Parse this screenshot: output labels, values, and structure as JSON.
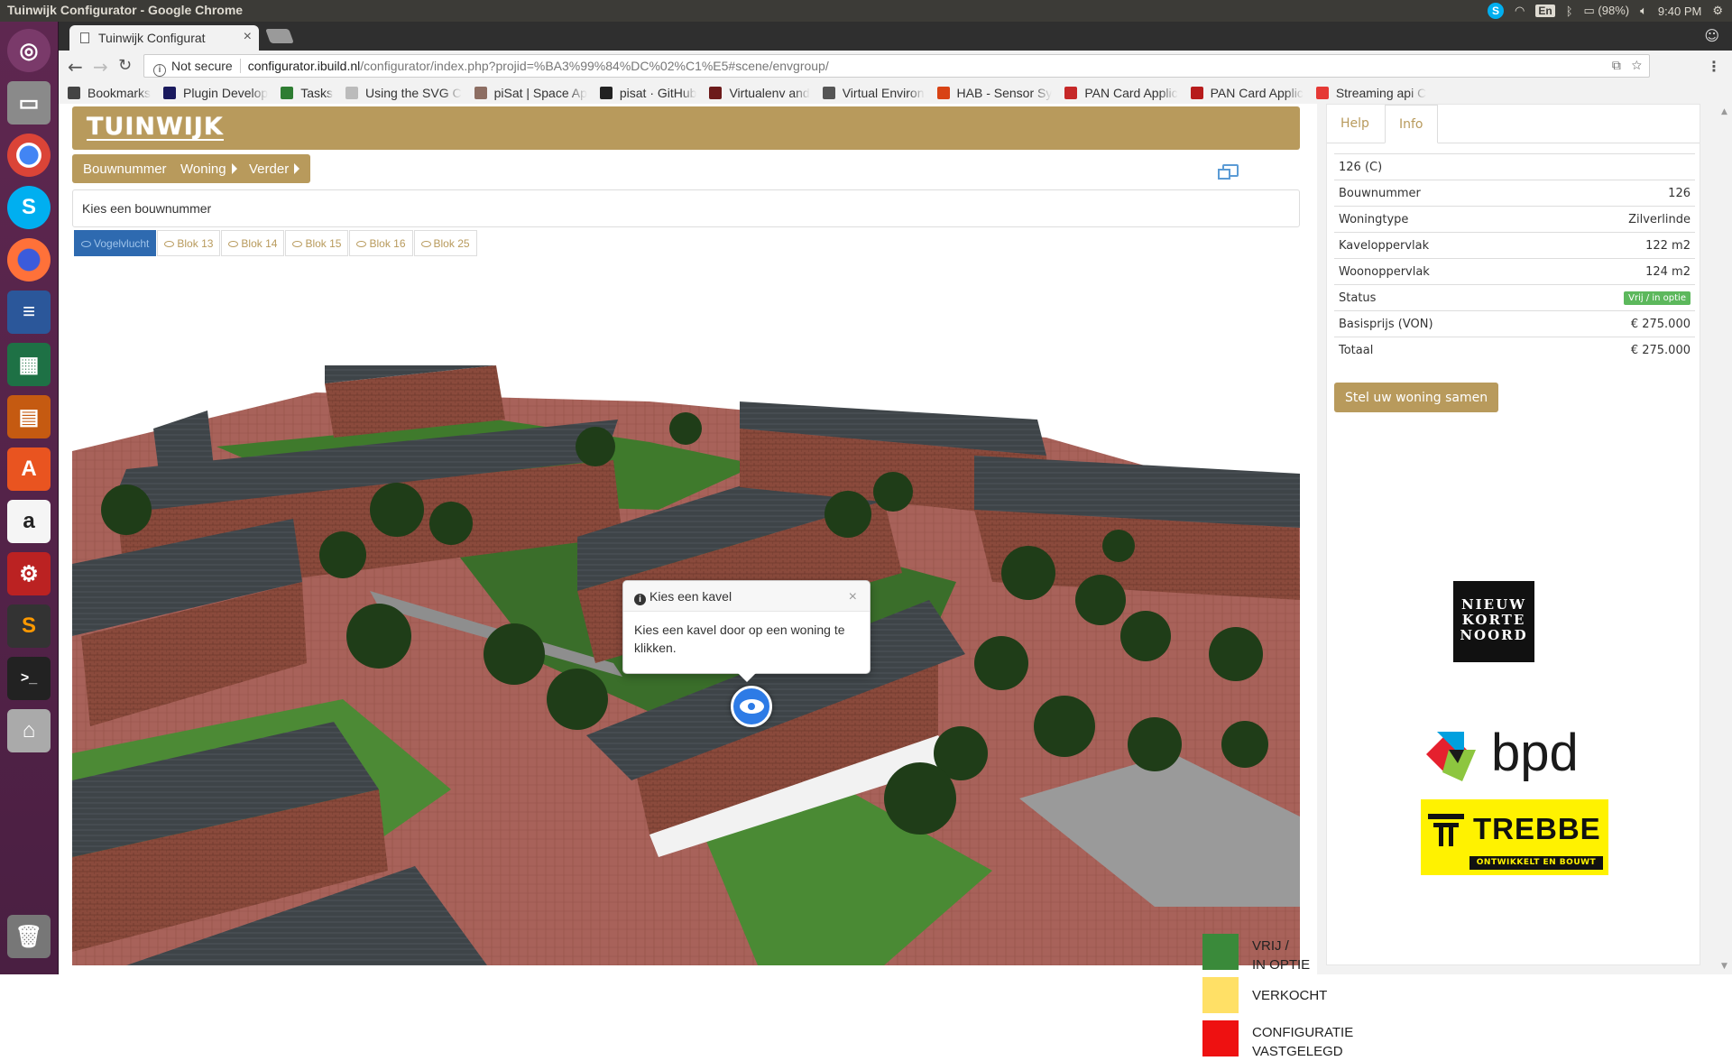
{
  "os": {
    "window_title": "Tuinwijk Configurator - Google Chrome",
    "language": "En",
    "battery": "(98%)",
    "clock": "9:40 PM"
  },
  "browser": {
    "tab_title": "Tuinwijk Configurat",
    "security": "Not secure",
    "url_host": "configurator.ibuild.nl",
    "url_path": "/configurator/index.php?projid=%BA3%99%84%DC%02%C1%E5#scene/envgroup/",
    "bookmarks": [
      {
        "label": "Bookmarks",
        "icon": "star-icon",
        "color": "#444444"
      },
      {
        "label": "Plugin Develop",
        "icon": "plugin-icon",
        "color": "#1a1a5e"
      },
      {
        "label": "Tasks",
        "icon": "tasks-icon",
        "color": "#2e7d32"
      },
      {
        "label": "Using the SVG C",
        "icon": "page-icon",
        "color": "#bbbbbb"
      },
      {
        "label": "piSat | Space Ap",
        "icon": "rocket-icon",
        "color": "#8d6e63"
      },
      {
        "label": "pisat · GitHub",
        "icon": "github-icon",
        "color": "#222222"
      },
      {
        "label": "Virtualenv and",
        "icon": "python-icon",
        "color": "#6d1b1b"
      },
      {
        "label": "Virtual Environ",
        "icon": "doc-icon",
        "color": "#555555"
      },
      {
        "label": "HAB - Sensor Sy",
        "icon": "hab-icon",
        "color": "#d84315"
      },
      {
        "label": "PAN Card Applic",
        "icon": "ca-icon",
        "color": "#c62828"
      },
      {
        "label": "PAN Card Applic",
        "icon": "nsdl-icon",
        "color": "#b71c1c"
      },
      {
        "label": "Streaming api C",
        "icon": "youtube-icon",
        "color": "#e53935"
      }
    ]
  },
  "app": {
    "logo_text": "TUINWIJK",
    "nav": [
      {
        "label": "Bouwnummer"
      },
      {
        "label": "Woning"
      },
      {
        "label": "Verder"
      }
    ],
    "prompt": "Kies een bouwnummer",
    "view_tabs": [
      {
        "label": "Vogelvlucht",
        "active": true
      },
      {
        "label": "Blok 13",
        "active": false
      },
      {
        "label": "Blok 14",
        "active": false
      },
      {
        "label": "Blok 15",
        "active": false
      },
      {
        "label": "Blok 16",
        "active": false
      },
      {
        "label": "Blok 25",
        "active": false
      }
    ],
    "popover": {
      "title": "Kies een kavel",
      "close": "×",
      "body": "Kies een kavel door op een woning te klikken."
    },
    "legend": [
      {
        "line1": "VRIJ /",
        "line2": "IN OPTIE",
        "color": "#3a8a3a"
      },
      {
        "line1": "VERKOCHT",
        "line2": "",
        "color": "#ffe066"
      },
      {
        "line1": "CONFIGURATIE",
        "line2": "VASTGELEGD",
        "color": "#ee1111"
      }
    ],
    "accent_color": "#b89a5c"
  },
  "info_panel": {
    "tabs": [
      "Help",
      "Info"
    ],
    "active_tab": "Info",
    "heading": "126 (C)",
    "rows": [
      {
        "label": "Bouwnummer",
        "value": "126"
      },
      {
        "label": "Woningtype",
        "value": "Zilverlinde"
      },
      {
        "label": "Kaveloppervlak",
        "value": "122 m2"
      },
      {
        "label": "Woonoppervlak",
        "value": "124 m2"
      },
      {
        "label": "Status",
        "value": "Vrij / in optie"
      },
      {
        "label": "Basisprijs (VON)",
        "value": "€ 275.000"
      },
      {
        "label": "Totaal",
        "value": "€ 275.000"
      }
    ],
    "button": "Stel uw woning samen",
    "partner_logos": {
      "nkn": [
        "NIEUW",
        "KORTE",
        "NOORD"
      ],
      "bpd": "bpd",
      "trebbe": "TREBBE",
      "trebbe_sub": "ONTWIKKELT EN BOUWT"
    }
  }
}
